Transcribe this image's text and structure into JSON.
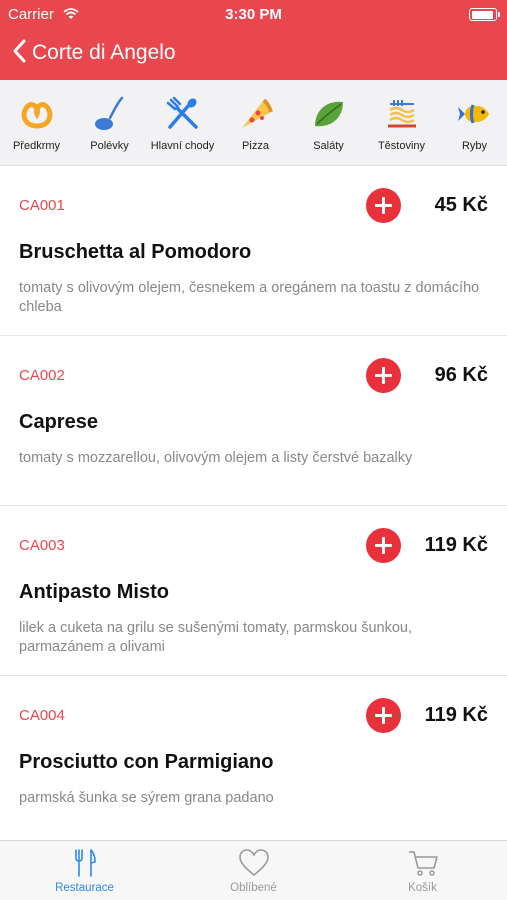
{
  "status_bar": {
    "carrier": "Carrier",
    "time": "3:30 PM"
  },
  "nav": {
    "back_title": "Corte di Angelo"
  },
  "categories": [
    {
      "label": "Předkrmy",
      "icon": "pretzel-icon"
    },
    {
      "label": "Polévky",
      "icon": "ladle-icon"
    },
    {
      "label": "Hlavní chody",
      "icon": "fork-spoon-icon"
    },
    {
      "label": "Pizza",
      "icon": "pizza-slice-icon"
    },
    {
      "label": "Saláty",
      "icon": "lettuce-leaf-icon"
    },
    {
      "label": "Těstoviny",
      "icon": "spaghetti-fork-icon"
    },
    {
      "label": "Ryby",
      "icon": "fish-icon"
    }
  ],
  "menu_items": [
    {
      "code": "CA001",
      "price": "45 Kč",
      "name": "Bruschetta al Pomodoro",
      "description": "tomaty s olivovým olejem, česnekem a oregánem na toastu z domácího chleba"
    },
    {
      "code": "CA002",
      "price": "96 Kč",
      "name": "Caprese",
      "description": "tomaty s mozzarellou, olivovým olejem a listy čerstvé bazalky"
    },
    {
      "code": "CA003",
      "price": "119 Kč",
      "name": "Antipasto Misto",
      "description": "lilek a cuketa na grilu se sušenými tomaty, parmskou šunkou, parmazánem a olivami"
    },
    {
      "code": "CA004",
      "price": "119 Kč",
      "name": "Prosciutto con Parmigiano",
      "description": "parmská šunka se sýrem grana padano"
    }
  ],
  "tabs": [
    {
      "label": "Restaurace",
      "icon": "fork-knife-icon",
      "active": true
    },
    {
      "label": "Oblíbené",
      "icon": "heart-icon",
      "active": false
    },
    {
      "label": "Košík",
      "icon": "cart-icon",
      "active": false
    }
  ],
  "colors": {
    "brand_red": "#e8474e",
    "add_button": "#e8313a",
    "tab_active": "#2a8ae8",
    "tab_inactive": "#999999"
  }
}
